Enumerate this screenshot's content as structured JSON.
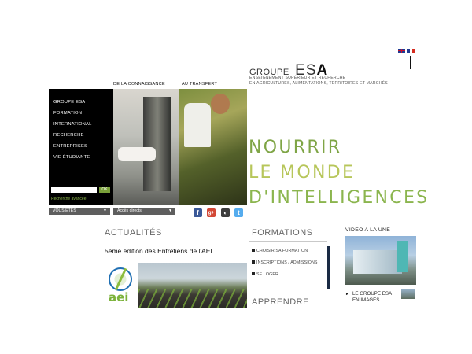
{
  "header": {
    "brand_groupe": "GROUPE",
    "brand_esa_prefix": "ES",
    "brand_esa_bold": "A",
    "tagline_line1": "ENSEIGNEMENT SUPÉRIEUR ET RECHERCHE",
    "tagline_line2": "EN AGRICULTURES, ALIMENTATIONS, TERRITOIRES ET MARCHÉS",
    "languages": [
      {
        "icon": "uk-flag-icon"
      },
      {
        "icon": "fr-flag-icon"
      }
    ]
  },
  "photos": {
    "caption_left": "DE LA CONNAISSANCE",
    "caption_right": "AU TRANSFERT"
  },
  "menu": {
    "items": [
      "GROUPE ESA",
      "FORMATION",
      "INTERNATIONAL",
      "RECHERCHE",
      "ENTREPRISES",
      "VIE ÉTUDIANTE"
    ],
    "search_value": "",
    "ok_label": "OK",
    "advanced_search": "Recherche avancée"
  },
  "dropdowns": {
    "vous_etes": "VOUS ÊTES",
    "acces_directs": "Accès directs"
  },
  "social": [
    {
      "icon": "facebook-icon",
      "glyph": "f",
      "color": "#3b5998"
    },
    {
      "icon": "google-plus-icon",
      "glyph": "g+",
      "color": "#d34836"
    },
    {
      "icon": "netvibes-icon",
      "glyph": "◐",
      "color": "#3c3c3c"
    },
    {
      "icon": "twitter-icon",
      "glyph": "t",
      "color": "#55acee"
    }
  ],
  "slogan": {
    "line1": "NOURRIR",
    "line2": "LE MONDE",
    "line3": "D'INTELLIGENCES"
  },
  "actualites": {
    "heading": "ACTUALITÉS",
    "news_title": "5ème édition des Entretiens de l'AEI",
    "logo_text": "aei"
  },
  "formations": {
    "heading": "FORMATIONS",
    "links": [
      "CHOISIR SA FORMATION",
      "INSCRIPTIONS / ADMISSIONS",
      "SE LOGER"
    ],
    "next_heading": "APPRENDRE"
  },
  "video": {
    "heading": "VIDEO A LA UNE",
    "caption_line1": "LE GROUPE ESA",
    "caption_line2": "EN IMAGES"
  }
}
